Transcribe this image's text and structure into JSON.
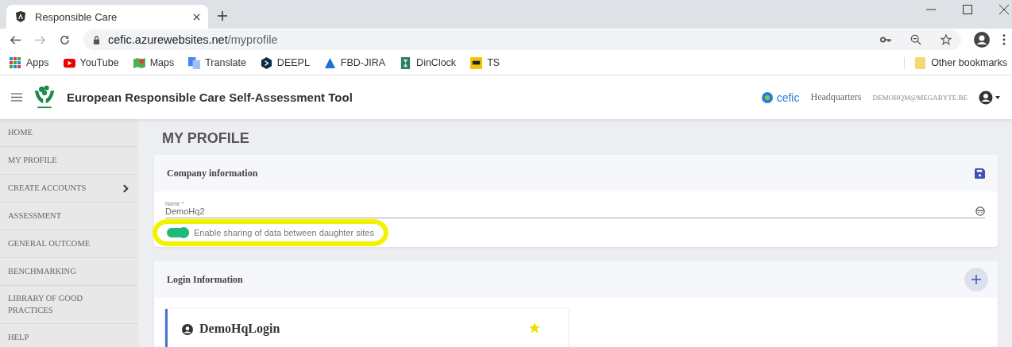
{
  "browser": {
    "tab_title": "Responsible Care",
    "url_host": "cefic.azurewebsites.net",
    "url_path": "/myprofile",
    "bookmarks": [
      {
        "label": "Apps",
        "kind": "apps"
      },
      {
        "label": "YouTube",
        "kind": "youtube"
      },
      {
        "label": "Maps",
        "kind": "maps"
      },
      {
        "label": "Translate",
        "kind": "translate"
      },
      {
        "label": "DEEPL",
        "kind": "deepl"
      },
      {
        "label": "FBD-JIRA",
        "kind": "jira"
      },
      {
        "label": "DinClock",
        "kind": "clock"
      },
      {
        "label": "TS",
        "kind": "ts"
      }
    ],
    "other_bookmarks": "Other bookmarks"
  },
  "header": {
    "title": "European Responsible Care Self-Assessment Tool",
    "brand": "cefic",
    "site": "Headquarters",
    "user": "DEMOHQM@MEGABYTE.BE"
  },
  "sidebar": {
    "items": [
      {
        "label": "HOME",
        "has_submenu": false
      },
      {
        "label": "MY PROFILE",
        "has_submenu": false
      },
      {
        "label": "CREATE ACCOUNTS",
        "has_submenu": true
      },
      {
        "label": "ASSESSMENT",
        "has_submenu": false
      },
      {
        "label": "GENERAL OUTCOME",
        "has_submenu": false
      },
      {
        "label": "BENCHMARKING",
        "has_submenu": false
      },
      {
        "label": "LIBRARY OF GOOD PRACTICES",
        "has_submenu": false
      },
      {
        "label": "HELP",
        "has_submenu": false
      }
    ]
  },
  "page_title": "MY PROFILE",
  "company": {
    "title": "Company information",
    "name_label": "Name *",
    "name_value": "DemoHq2",
    "sharing": {
      "label": "Enable sharing of data between daughter sites",
      "on": true
    }
  },
  "login": {
    "title": "Login Information",
    "accounts": [
      {
        "name": "DemoHqLogin",
        "favorite": true
      }
    ]
  }
}
